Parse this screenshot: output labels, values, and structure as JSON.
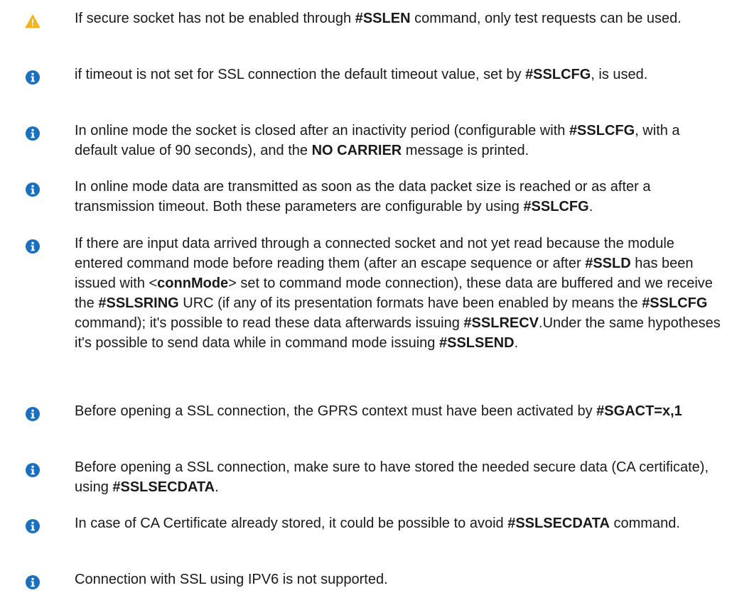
{
  "notes": [
    {
      "icon": "warning-icon",
      "segments": [
        {
          "t": "If secure socket has not be enabled through "
        },
        {
          "t": "#SSLEN",
          "b": true
        },
        {
          "t": " command, only test requests can be used."
        }
      ]
    },
    {
      "icon": "info-icon",
      "segments": [
        {
          "t": "if timeout is not set for SSL connection the default timeout value, set by "
        },
        {
          "t": "#SSLCFG",
          "b": true
        },
        {
          "t": ", is used."
        }
      ]
    },
    {
      "icon": "info-icon",
      "segments": [
        {
          "t": "In online mode the socket is closed after an inactivity period (configurable with "
        },
        {
          "t": "#SSLCFG",
          "b": true
        },
        {
          "t": ", with a default value of 90 seconds), and the "
        },
        {
          "t": "NO CARRIER",
          "b": true
        },
        {
          "t": " message is printed."
        }
      ]
    },
    {
      "icon": "info-icon",
      "segments": [
        {
          "t": "In online mode data are transmitted as soon as the data packet size is reached or as after a transmission timeout. Both these parameters are configurable by using "
        },
        {
          "t": "#SSLCFG",
          "b": true
        },
        {
          "t": "."
        }
      ]
    },
    {
      "icon": "info-icon",
      "segments": [
        {
          "t": "If there are input data arrived through a connected socket and not yet read because the module entered command mode before reading them (after an escape sequence or after "
        },
        {
          "t": "#SSLD",
          "b": true
        },
        {
          "t": " has been issued with <"
        },
        {
          "t": "connMode",
          "b": true
        },
        {
          "t": "> set to command mode connection), these data are buffered and we receive the "
        },
        {
          "t": "#SSLSRING",
          "b": true
        },
        {
          "t": " URC (if any of its presentation formats have been enabled by means the "
        },
        {
          "t": "#SSLCFG",
          "b": true
        },
        {
          "t": " command); it's possible to read these data afterwards issuing "
        },
        {
          "t": "#SSLRECV",
          "b": true
        },
        {
          "t": ".Under the same hypotheses it's possible to send data while in command mode issuing "
        },
        {
          "t": "#SSLSEND",
          "b": true
        },
        {
          "t": "."
        }
      ]
    },
    {
      "icon": "info-icon",
      "segments": [
        {
          "t": "Before opening a SSL connection, the GPRS context must have been activated by "
        },
        {
          "t": "#SGACT=x,1",
          "b": true
        }
      ]
    },
    {
      "icon": "info-icon",
      "segments": [
        {
          "t": "Before opening a SSL connection, make sure to have stored the needed secure data (CA certificate), using "
        },
        {
          "t": "#SSLSECDATA",
          "b": true
        },
        {
          "t": "."
        }
      ]
    },
    {
      "icon": "info-icon",
      "segments": [
        {
          "t": "In case of CA Certificate already stored, it could be possible to avoid "
        },
        {
          "t": "#SSLSECDATA",
          "b": true
        },
        {
          "t": " command."
        }
      ]
    },
    {
      "icon": "info-icon",
      "segments": [
        {
          "t": "Connection with SSL using IPV6 is not supported."
        }
      ]
    }
  ],
  "colors": {
    "warning": "#f2b51c",
    "info": "#1b6fbf",
    "text": "#1a1a1a"
  }
}
